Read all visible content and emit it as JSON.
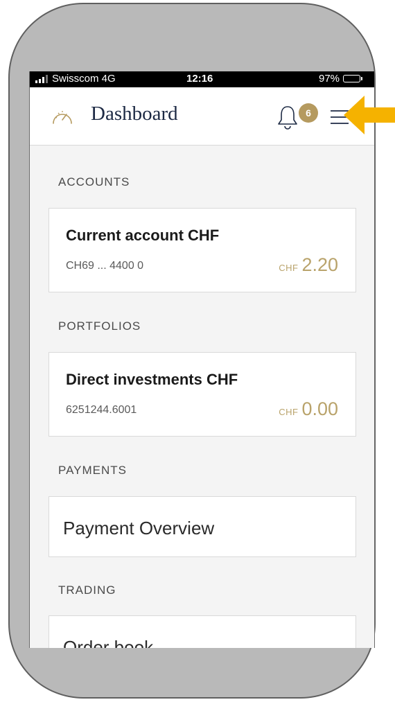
{
  "status_bar": {
    "carrier": "Swisscom 4G",
    "time": "12:16",
    "battery_percent": "97%",
    "battery_level": 0.97
  },
  "header": {
    "title": "Dashboard",
    "notification_count": "6",
    "icons": [
      "speedometer-icon",
      "bell-icon",
      "hamburger-menu-icon"
    ]
  },
  "sections": {
    "accounts": {
      "title": "ACCOUNTS",
      "card": {
        "name": "Current account CHF",
        "number": "CH69 ... 4400 0",
        "currency": "CHF",
        "amount": "2.20"
      }
    },
    "portfolios": {
      "title": "PORTFOLIOS",
      "card": {
        "name": "Direct investments CHF",
        "number": "6251244.6001",
        "currency": "CHF",
        "amount": "0.00"
      }
    },
    "payments": {
      "title": "PAYMENTS",
      "card": {
        "label": "Payment Overview"
      }
    },
    "trading": {
      "title": "TRADING",
      "card": {
        "label": "Order book"
      }
    }
  },
  "colors": {
    "accent_gold": "#b59a5f",
    "amount_gold": "#b9a36b",
    "title_navy": "#1d2a44",
    "pointer_arrow": "#f5b200"
  }
}
